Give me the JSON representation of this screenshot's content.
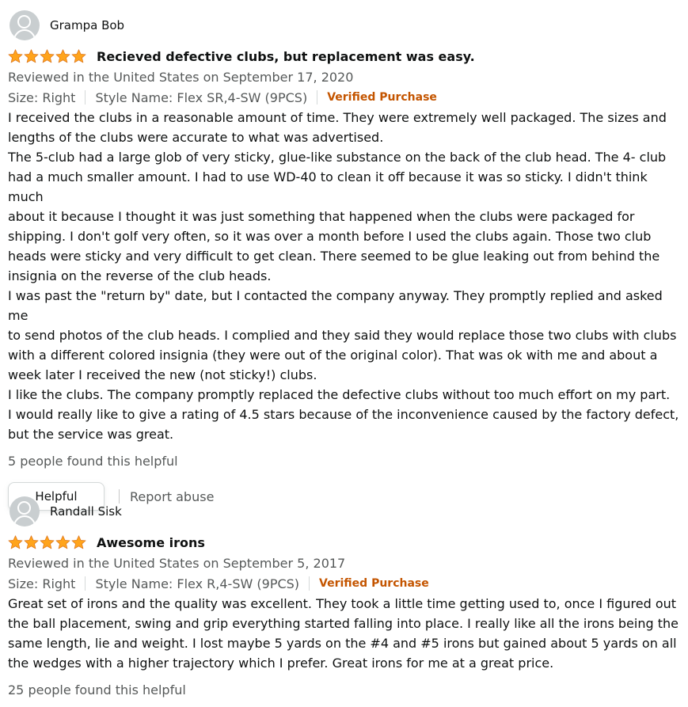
{
  "colors": {
    "star": "#ffa41c",
    "verified": "#c45500",
    "secondary_text": "#565959",
    "primary_text": "#0f1111"
  },
  "reviews": [
    {
      "author": "Grampa Bob",
      "rating": 5,
      "title": "Recieved defective clubs, but replacement was easy.",
      "date": "Reviewed in the United States on September 17, 2020",
      "size": "Size: Right",
      "style": "Style Name: Flex SR,4-SW (9PCS)",
      "verified": "Verified Purchase",
      "body": "I received the clubs in a reasonable amount of time. They were extremely well packaged. The sizes and\nlengths of the clubs were accurate to what was advertised.\nThe 5-club had a large glob of very sticky, glue-like substance on the back of the club head. The 4- club\nhad a much smaller amount. I had to use WD-40 to clean it off because it was so sticky. I didn't think much\nabout it because I thought it was just something that happened when the clubs were packaged for\nshipping. I don't golf very often, so it was over a month before I used the clubs again. Those two club\nheads were sticky and very difficult to get clean. There seemed to be glue leaking out from behind the\ninsignia on the reverse of the club heads.\nI was past the \"return by\" date, but I contacted the company anyway. They promptly replied and asked me\nto send photos of the club heads. I complied and they said they would replace those two clubs with clubs\nwith a different colored insignia (they were out of the original color). That was ok with me and about a\nweek later I received the new (not sticky!) clubs.\nI like the clubs. The company promptly replaced the defective clubs without too much effort on my part.\nI would really like to give a rating of 4.5 stars because of the inconvenience caused by the factory defect,\nbut the service was great.",
      "helpful_count": "5 people found this helpful",
      "helpful_button": "Helpful",
      "report": "Report abuse"
    },
    {
      "author": "Randall Sisk",
      "rating": 5,
      "title": "Awesome irons",
      "date": "Reviewed in the United States on September 5, 2017",
      "size": "Size: Right",
      "style": "Style Name: Flex R,4-SW (9PCS)",
      "verified": "Verified Purchase",
      "body": "Great set of irons and the quality was excellent. They took a little time getting used to, once I figured out\nthe ball placement, swing and grip everything started falling into place. I really like all the irons being the\nsame length, lie and weight. I lost maybe 5 yards on the #4 and #5 irons but gained about 5 yards on all\nthe wedges with a higher trajectory which I prefer. Great irons for me at a great price.",
      "helpful_count": "25 people found this helpful"
    }
  ]
}
